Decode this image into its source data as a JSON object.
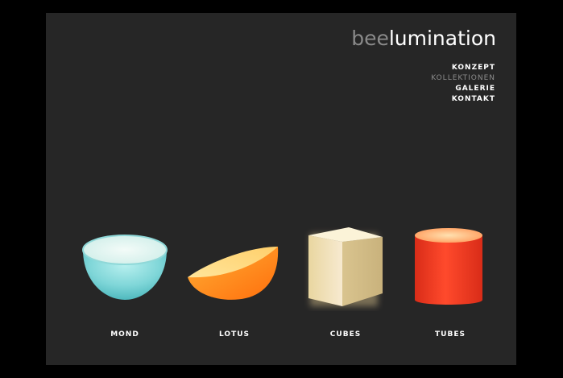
{
  "brand": {
    "prefix": "bee",
    "name": "lumination"
  },
  "nav": {
    "items": [
      {
        "label": "KONZEPT"
      },
      {
        "label": "KOLLEKTIONEN"
      },
      {
        "label": "GALERIE"
      },
      {
        "label": "KONTAKT"
      }
    ],
    "active_index": 1
  },
  "products": [
    {
      "label": "MOND",
      "color": "#7fd6d8"
    },
    {
      "label": "LOTUS",
      "color": "#ff8a1a"
    },
    {
      "label": "CUBES",
      "color": "#f3e2b0"
    },
    {
      "label": "TUBES",
      "color": "#ff3b1f"
    }
  ],
  "colors": {
    "background": "#000000",
    "panel": "#262626",
    "text": "#ffffff",
    "muted": "#8c8c8c"
  }
}
